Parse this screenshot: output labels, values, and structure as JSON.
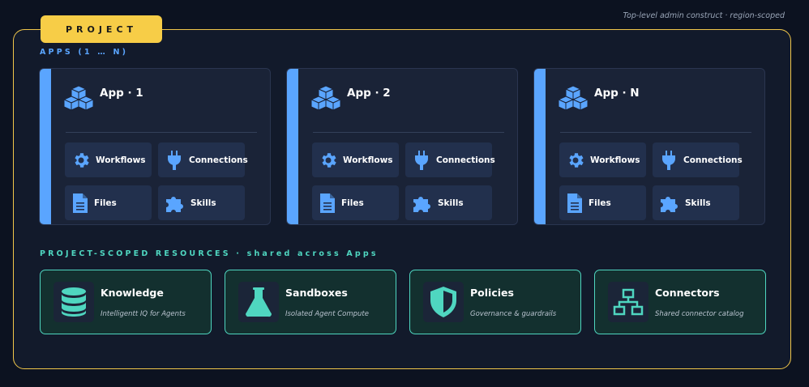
{
  "note": "Top-level admin construct  ·  region-scoped",
  "project_label": "PROJECT",
  "apps_section_title": "APPS  (1 … N)",
  "apps": [
    {
      "name": "App · 1",
      "features": {
        "workflows": "Workflows",
        "connections": "Connections",
        "files": "Files",
        "skills": "Skills"
      }
    },
    {
      "name": "App · 2",
      "features": {
        "workflows": "Workflows",
        "connections": "Connections",
        "files": "Files",
        "skills": "Skills"
      }
    },
    {
      "name": "App · N",
      "features": {
        "workflows": "Workflows",
        "connections": "Connections",
        "files": "Files",
        "skills": "Skills"
      }
    }
  ],
  "resources_section_title": "PROJECT-SCOPED RESOURCES  ·  shared across Apps",
  "resources": [
    {
      "name": "Knowledge",
      "subtitle": "Intelligentt IQ for Agents",
      "icon": "database-icon"
    },
    {
      "name": "Sandboxes",
      "subtitle": "Isolated Agent Compute",
      "icon": "flask-icon"
    },
    {
      "name": "Policies",
      "subtitle": "Governance & guardrails",
      "icon": "shield-icon"
    },
    {
      "name": "Connectors",
      "subtitle": "Shared connector catalog",
      "icon": "network-icon"
    }
  ],
  "colors": {
    "background": "#0c1220",
    "project_border": "#f0c64a",
    "project_tab": "#f7cd47",
    "app_accent": "#5aa5ff",
    "resource_accent": "#4fd6c0"
  }
}
